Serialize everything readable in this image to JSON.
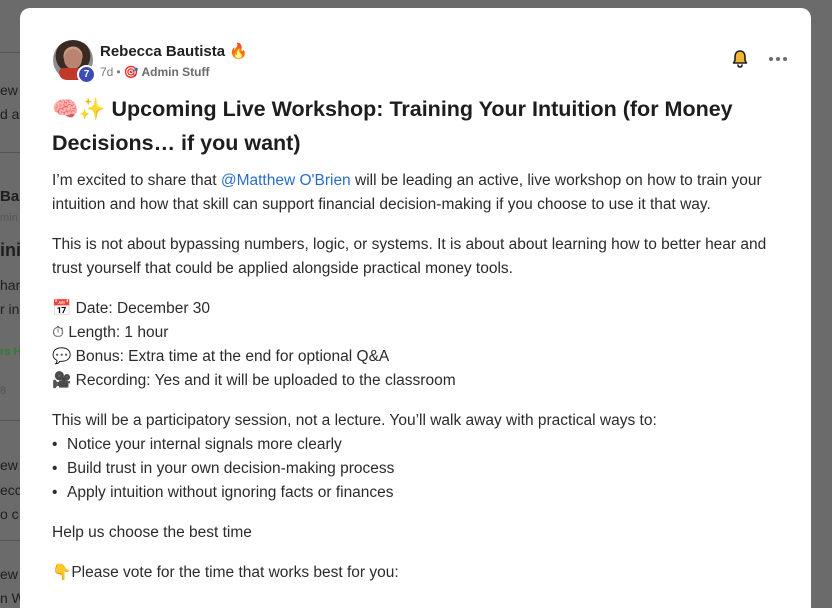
{
  "background_feed": {
    "fragments": [
      "ew",
      "d at",
      "Ba",
      "min",
      "ini",
      "har",
      "r in",
      "rs H",
      "8",
      "ew",
      "ecc",
      "o c",
      "ew",
      "n W"
    ]
  },
  "post": {
    "author": {
      "name": "Rebecca Bautista",
      "name_emoji": "🔥",
      "level": "7"
    },
    "time_ago": "7d",
    "separator": "•",
    "category_icon": "🎯",
    "category": "Admin Stuff",
    "title": "🧠✨ Upcoming Live Workshop: Training Your Intuition (for Money Decisions… if you want)",
    "intro_before_mention": "I’m excited to share that ",
    "mention": "@Matthew O'Brien",
    "intro_after_mention": " will be leading an active, live workshop on how to train your intuition and how that skill can support financial decision-making if you choose to use it that way.",
    "paragraph_2": "This is not about bypassing numbers, logic, or systems. It is about about learning how to better hear and trust yourself that could be applied alongside practical money tools.",
    "details": [
      {
        "icon": "📅",
        "text": "Date: December 30"
      },
      {
        "icon": "⏱",
        "text": "Length: 1 hour"
      },
      {
        "icon": "💬",
        "text": "Bonus: Extra time at the end for optional Q&A"
      },
      {
        "icon": "🎥",
        "text": "Recording: Yes and it will be uploaded to the classroom"
      }
    ],
    "paragraph_3": "This will be a participatory session, not a lecture. You’ll walk away with practical ways to:",
    "bullets": [
      "Notice your internal signals more clearly",
      "Build trust in your own decision-making process",
      "Apply intuition without ignoring facts or finances"
    ],
    "bullet_char": "•",
    "paragraph_4": "Help us choose the best time",
    "paragraph_5_icon": "👇",
    "paragraph_5": "Please vote for the time that works best for you:"
  },
  "icons": {
    "bell": "bell-icon",
    "more": "more-options-icon"
  },
  "colors": {
    "mention": "#2a6dc9",
    "level_badge": "#3b4cb8",
    "overlay": "#6b6b6b",
    "bell_fill": "#f2b632"
  }
}
